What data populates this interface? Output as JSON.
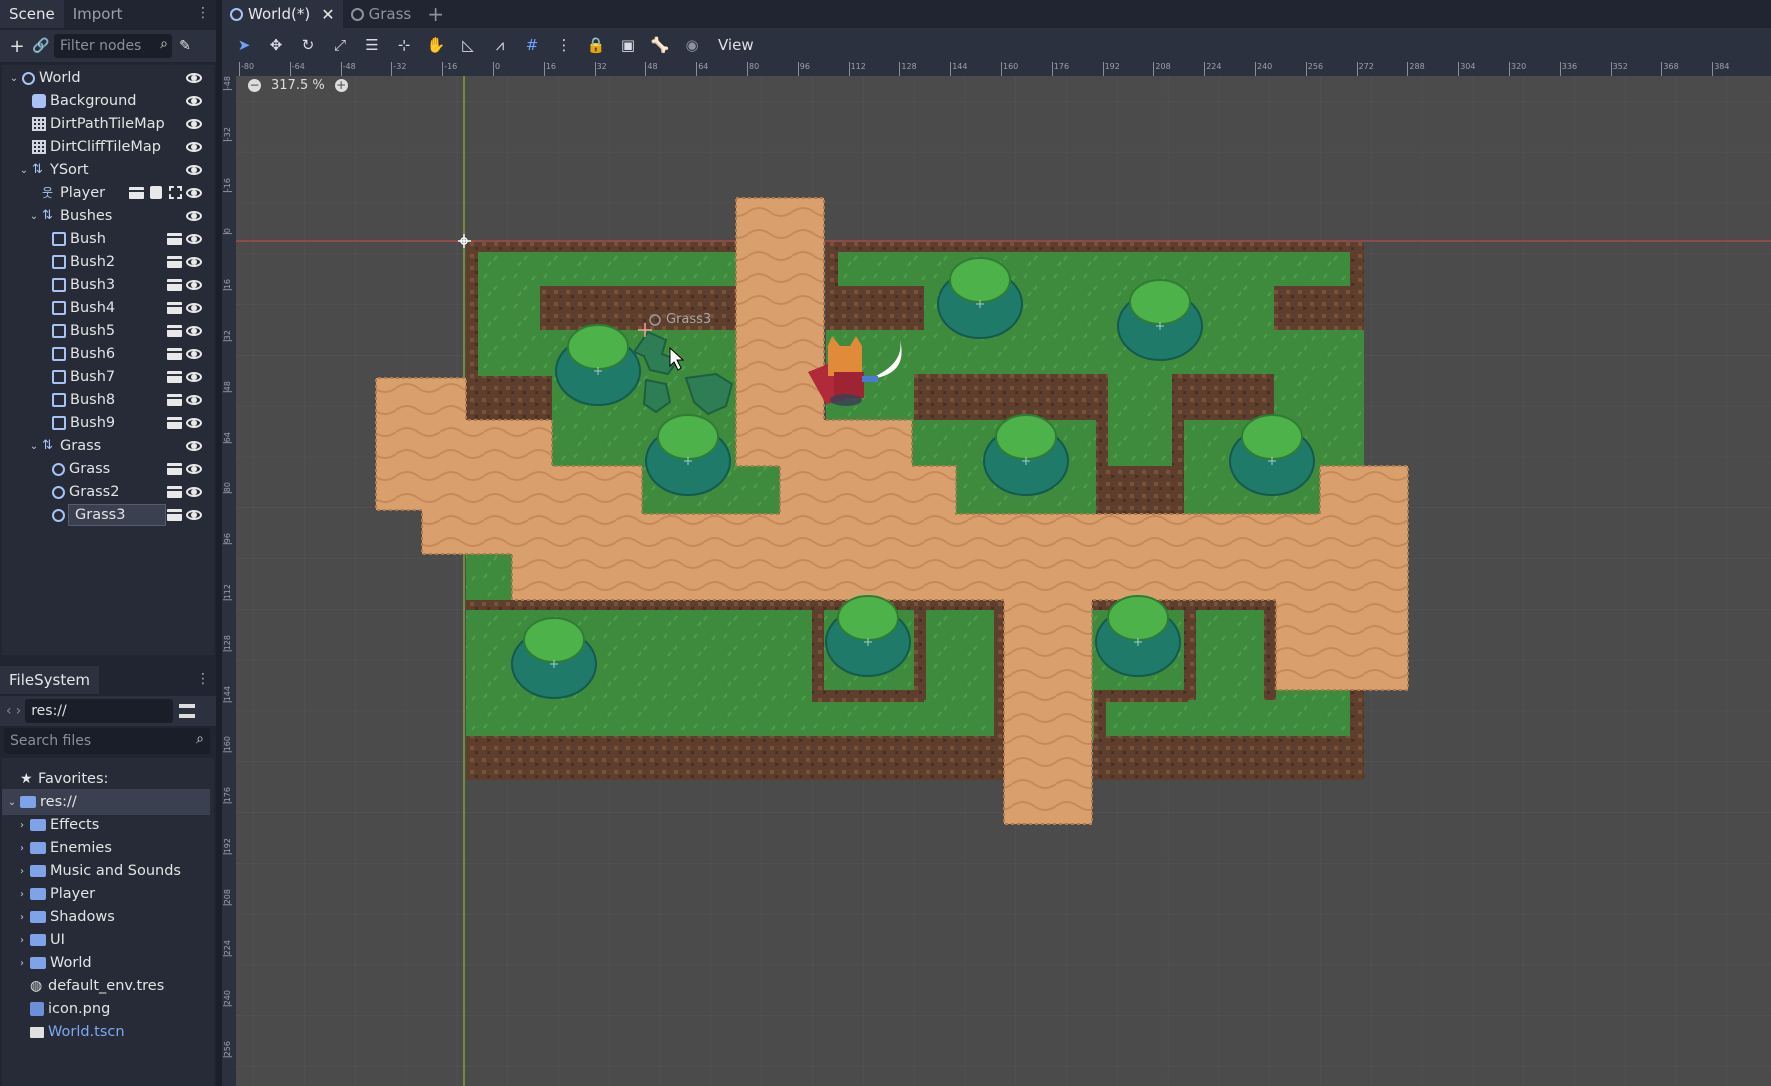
{
  "scene_dock": {
    "tabs": [
      "Scene",
      "Import"
    ],
    "filter_placeholder": "Filter nodes",
    "tree": [
      {
        "label": "World",
        "depth": 0,
        "icon": "node2d-icon",
        "caret": "open",
        "badges": []
      },
      {
        "label": "Background",
        "depth": 1,
        "icon": "sprite-icon",
        "caret": "",
        "badges": []
      },
      {
        "label": "DirtPathTileMap",
        "depth": 1,
        "icon": "tilemap-icon",
        "caret": "",
        "badges": []
      },
      {
        "label": "DirtCliffTileMap",
        "depth": 1,
        "icon": "tilemap-icon",
        "caret": "",
        "badges": []
      },
      {
        "label": "YSort",
        "depth": 1,
        "icon": "ysort-icon",
        "caret": "open",
        "badges": []
      },
      {
        "label": "Player",
        "depth": 2,
        "icon": "kinematic-icon",
        "caret": "",
        "badges": [
          "instance-icon",
          "script-icon",
          "group-icon"
        ]
      },
      {
        "label": "Bushes",
        "depth": 2,
        "icon": "ysort-icon",
        "caret": "open",
        "badges": []
      },
      {
        "label": "Bush",
        "depth": 3,
        "icon": "staticbody-icon",
        "caret": "",
        "badges": [
          "instance-icon"
        ]
      },
      {
        "label": "Bush2",
        "depth": 3,
        "icon": "staticbody-icon",
        "caret": "",
        "badges": [
          "instance-icon"
        ]
      },
      {
        "label": "Bush3",
        "depth": 3,
        "icon": "staticbody-icon",
        "caret": "",
        "badges": [
          "instance-icon"
        ]
      },
      {
        "label": "Bush4",
        "depth": 3,
        "icon": "staticbody-icon",
        "caret": "",
        "badges": [
          "instance-icon"
        ]
      },
      {
        "label": "Bush5",
        "depth": 3,
        "icon": "staticbody-icon",
        "caret": "",
        "badges": [
          "instance-icon"
        ]
      },
      {
        "label": "Bush6",
        "depth": 3,
        "icon": "staticbody-icon",
        "caret": "",
        "badges": [
          "instance-icon"
        ]
      },
      {
        "label": "Bush7",
        "depth": 3,
        "icon": "staticbody-icon",
        "caret": "",
        "badges": [
          "instance-icon"
        ]
      },
      {
        "label": "Bush8",
        "depth": 3,
        "icon": "staticbody-icon",
        "caret": "",
        "badges": [
          "instance-icon"
        ]
      },
      {
        "label": "Bush9",
        "depth": 3,
        "icon": "staticbody-icon",
        "caret": "",
        "badges": [
          "instance-icon"
        ]
      },
      {
        "label": "Grass",
        "depth": 2,
        "icon": "ysort-icon",
        "caret": "open",
        "badges": []
      },
      {
        "label": "Grass",
        "depth": 3,
        "icon": "node2d-icon",
        "caret": "",
        "badges": [
          "instance-icon"
        ]
      },
      {
        "label": "Grass2",
        "depth": 3,
        "icon": "node2d-icon",
        "caret": "",
        "badges": [
          "instance-icon"
        ]
      },
      {
        "label": "Grass3",
        "depth": 3,
        "icon": "node2d-icon",
        "caret": "",
        "badges": [
          "instance-icon"
        ],
        "selected": true
      }
    ]
  },
  "filesystem": {
    "tab": "FileSystem",
    "path": "res://",
    "search_placeholder": "Search files",
    "items": [
      {
        "label": "Favorites:",
        "icon": "star-icon",
        "depth": 0,
        "caret": ""
      },
      {
        "label": "res://",
        "icon": "folder-icon",
        "depth": 0,
        "caret": "open",
        "selected": true
      },
      {
        "label": "Effects",
        "icon": "folder-icon",
        "depth": 1,
        "caret": "closed"
      },
      {
        "label": "Enemies",
        "icon": "folder-icon",
        "depth": 1,
        "caret": "closed"
      },
      {
        "label": "Music and Sounds",
        "icon": "folder-icon",
        "depth": 1,
        "caret": "closed"
      },
      {
        "label": "Player",
        "icon": "folder-icon",
        "depth": 1,
        "caret": "closed"
      },
      {
        "label": "Shadows",
        "icon": "folder-icon",
        "depth": 1,
        "caret": "closed"
      },
      {
        "label": "UI",
        "icon": "folder-icon",
        "depth": 1,
        "caret": "closed"
      },
      {
        "label": "World",
        "icon": "folder-icon",
        "depth": 1,
        "caret": "closed"
      },
      {
        "label": "default_env.tres",
        "icon": "environment-icon",
        "depth": 1,
        "caret": ""
      },
      {
        "label": "icon.png",
        "icon": "image-icon",
        "depth": 1,
        "caret": ""
      },
      {
        "label": "World.tscn",
        "icon": "scene-icon",
        "depth": 1,
        "caret": "",
        "highlight": true
      }
    ]
  },
  "editor_tabs": [
    {
      "label": "World(*)",
      "active": true
    },
    {
      "label": "Grass",
      "active": false
    }
  ],
  "toolbar": {
    "view_menu": "View"
  },
  "viewport": {
    "zoom": "317.5 %",
    "selected_node_label": "Grass3",
    "ruler_top": [
      "-80",
      "-64",
      "-48",
      "-32",
      "-16",
      "0",
      "16",
      "32",
      "48",
      "64",
      "80",
      "96",
      "112",
      "128",
      "144",
      "160",
      "176",
      "192",
      "208",
      "224",
      "240",
      "256",
      "272",
      "288",
      "304",
      "320",
      "336",
      "352",
      "368",
      "384"
    ],
    "ruler_left": [
      "-48",
      "-32",
      "-16",
      "0",
      "16",
      "32",
      "48",
      "64",
      "80",
      "96",
      "112",
      "128",
      "144",
      "160",
      "176",
      "192",
      "208",
      "224",
      "240",
      "256"
    ]
  },
  "colors": {
    "grass": "#3d8a3c",
    "dirt": "#d69c6b",
    "cliff": "#5c3d2e",
    "bush": "#1f7a6a",
    "viewport_bg": "#4b4b4b"
  }
}
